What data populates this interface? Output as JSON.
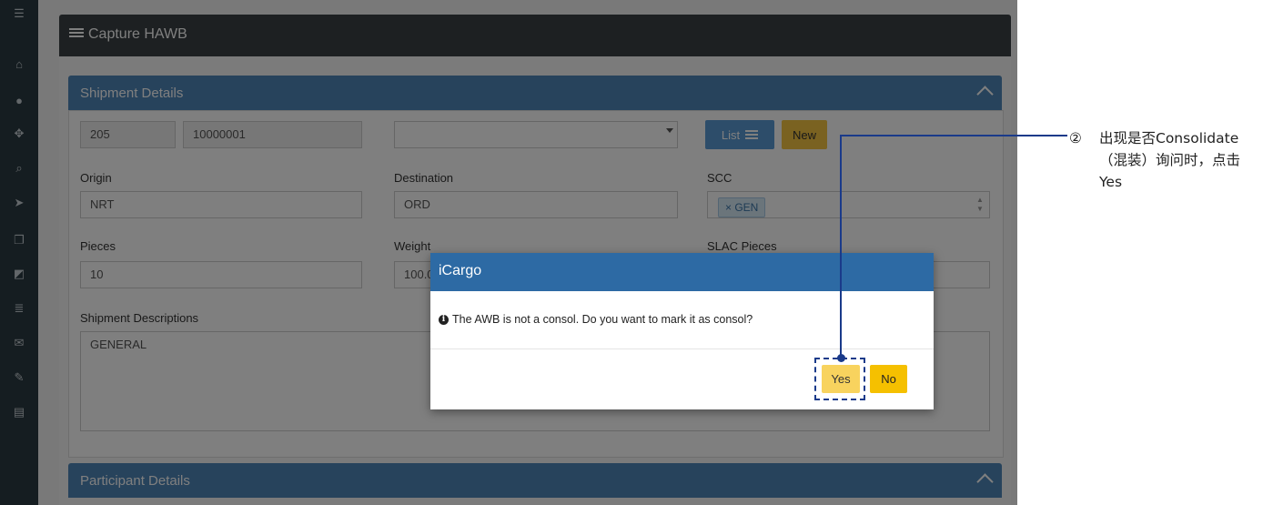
{
  "page_title": "Capture HAWB",
  "sidebar_icons": [
    "menu-icon",
    "home-icon",
    "user-icon",
    "move-icon",
    "search-icon",
    "send-icon",
    "copy-icon",
    "external-icon",
    "list-icon",
    "mail-icon",
    "edit-icon",
    "pdf-icon"
  ],
  "shipment": {
    "header": "Shipment Details",
    "awb_prefix": "205",
    "awb_number": "10000001",
    "hawb_select": "",
    "list_label": "List",
    "new_label": "New",
    "origin_label": "Origin",
    "origin_value": "NRT",
    "destination_label": "Destination",
    "destination_value": "ORD",
    "scc_label": "SCC",
    "scc_tag": "× GEN",
    "pieces_label": "Pieces",
    "pieces_value": "10",
    "weight_label": "Weight",
    "weight_value": "100.0",
    "slac_label": "SLAC Pieces",
    "slac_value": "",
    "desc_label": "Shipment Descriptions",
    "desc_value": "GENERAL"
  },
  "participant": {
    "header": "Participant Details"
  },
  "modal": {
    "title": "iCargo",
    "message": "The AWB is not a consol. Do you want to mark it as consol?",
    "yes_label": "Yes",
    "no_label": "No"
  },
  "annotation": {
    "number": "②",
    "text": "出现是否Consolidate（混装）询问时，点击Yes",
    "color": "#1a3a8a"
  }
}
